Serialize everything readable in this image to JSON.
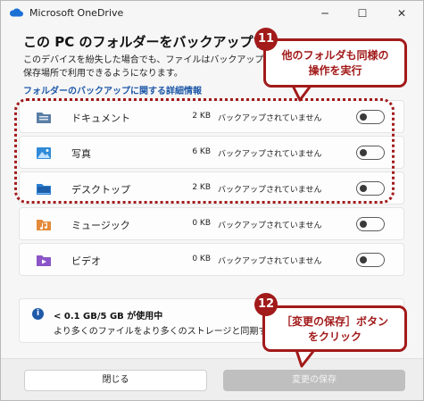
{
  "window": {
    "title": "Microsoft OneDrive",
    "controls": {
      "minimize": "─",
      "maximize": "☐",
      "close": "✕"
    }
  },
  "header": {
    "title": "この PC のフォルダーをバックアップする",
    "description": "このデバイスを紛失した場合でも、ファイルはバックアップされ、保存場所で利用できるようになります。",
    "link": "フォルダーのバックアップに関する詳細情報"
  },
  "folders": [
    {
      "name": "ドキュメント",
      "size": "2 KB",
      "status": "バックアップされていません",
      "icon": "documents-folder-icon",
      "color": "#5b7fa6",
      "backup_on": false
    },
    {
      "name": "写真",
      "size": "6 KB",
      "status": "バックアップされていません",
      "icon": "pictures-folder-icon",
      "color": "#2f8ad8",
      "backup_on": false
    },
    {
      "name": "デスクトップ",
      "size": "2 KB",
      "status": "バックアップされていません",
      "icon": "desktop-folder-icon",
      "color": "#2b7fd4",
      "backup_on": false
    },
    {
      "name": "ミュージック",
      "size": "0 KB",
      "status": "バックアップされていません",
      "icon": "music-folder-icon",
      "color": "#e58a3a",
      "backup_on": false
    },
    {
      "name": "ビデオ",
      "size": "0 KB",
      "status": "バックアップされていません",
      "icon": "videos-folder-icon",
      "color": "#8b55c7",
      "backup_on": false
    }
  ],
  "storage": {
    "usage": "< 0.1 GB/5 GB が使用中",
    "hint": "より多くのファイルをより多くのストレージと同期する",
    "info_icon": "i"
  },
  "buttons": {
    "close": "閉じる",
    "save": "変更の保存"
  },
  "annotations": [
    {
      "badge": "11",
      "text_line1": "他のフォルダも同様の",
      "text_line2": "操作を実行"
    },
    {
      "badge": "12",
      "text_line1": "［変更の保存］ボタン",
      "text_line2": "をクリック"
    }
  ],
  "colors": {
    "annotation": "#a21a1a",
    "link": "#1f5aa8",
    "disabled_button": "#bfbfbf"
  }
}
